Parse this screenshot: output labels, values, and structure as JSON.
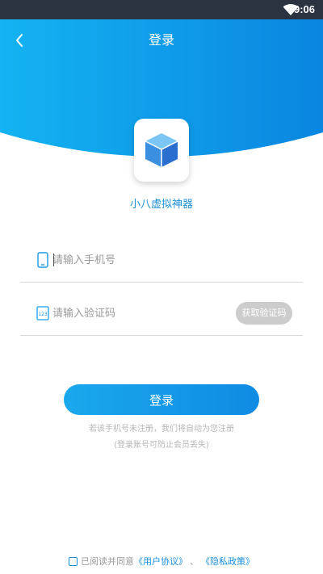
{
  "status_bar": {
    "time": "9:06",
    "wifi_icon": "wifi-icon"
  },
  "header": {
    "title": "登录",
    "back_icon": "chevron-left-icon"
  },
  "app": {
    "name": "小八虚拟神器",
    "logo_icon": "cube-icon"
  },
  "form": {
    "phone": {
      "placeholder": "请输入手机号",
      "value": "",
      "icon": "phone-icon"
    },
    "code": {
      "placeholder": "请输入验证码",
      "value": "",
      "icon": "code-icon",
      "get_code_label": "获取验证码"
    }
  },
  "login_button": {
    "label": "登录"
  },
  "hints": {
    "line1": "若该手机号未注册，我们将自动为您注册",
    "line2": "(登录账号可防止会员丢失)"
  },
  "agreement": {
    "prefix": "已阅读并同意",
    "user_agreement": "《用户协议》",
    "separator": "、",
    "privacy_policy": "《隐私政策》",
    "checked": false
  },
  "colors": {
    "accent": "#1a9ae8",
    "status_bar": "#2b3240",
    "get_code_disabled": "#cccccc"
  }
}
